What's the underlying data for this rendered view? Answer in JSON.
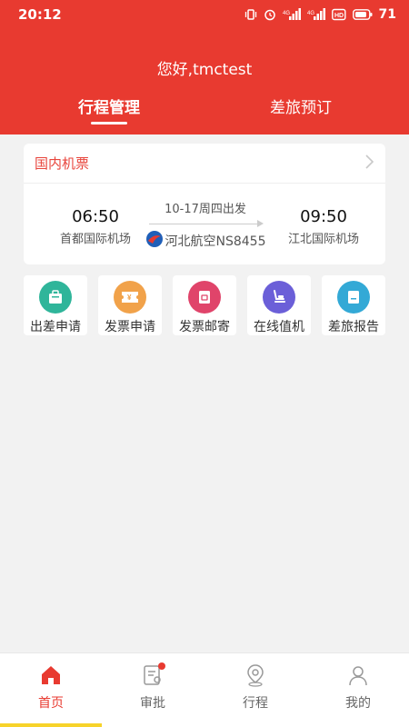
{
  "status_bar": {
    "time": "20:12",
    "battery_level": "71",
    "icons": [
      "vibrate-icon",
      "alarm-icon",
      "signal-icon",
      "signal-icon",
      "hd-icon",
      "battery-icon"
    ]
  },
  "header": {
    "greeting": "您好,tmctest",
    "tabs": [
      {
        "label": "行程管理",
        "active": true
      },
      {
        "label": "差旅预订",
        "active": false
      }
    ]
  },
  "trip_card": {
    "title": "国内机票",
    "departure": {
      "time": "06:50",
      "airport": "首都国际机场"
    },
    "arrival": {
      "time": "09:50",
      "airport": "江北国际机场"
    },
    "date": "10-17周四出发",
    "airline": "河北航空NS8455"
  },
  "actions": [
    {
      "label": "出差申请",
      "icon": "briefcase-icon",
      "color": "#2fb59a"
    },
    {
      "label": "发票申请",
      "icon": "ticket-icon",
      "color": "#f1a24a"
    },
    {
      "label": "发票邮寄",
      "icon": "mail-icon",
      "color": "#e0446a"
    },
    {
      "label": "在线值机",
      "icon": "seat-icon",
      "color": "#6b5fd8"
    },
    {
      "label": "差旅报告",
      "icon": "report-icon",
      "color": "#33a9d6"
    }
  ],
  "bottom_nav": [
    {
      "label": "首页",
      "icon": "home-icon",
      "active": true
    },
    {
      "label": "审批",
      "icon": "approval-icon",
      "active": false,
      "badge": true
    },
    {
      "label": "行程",
      "icon": "location-icon",
      "active": false
    },
    {
      "label": "我的",
      "icon": "user-icon",
      "active": false
    }
  ],
  "colors": {
    "brand": "#e83a30",
    "background": "#f2f2f2",
    "home_indicator": "#f7d32a"
  }
}
